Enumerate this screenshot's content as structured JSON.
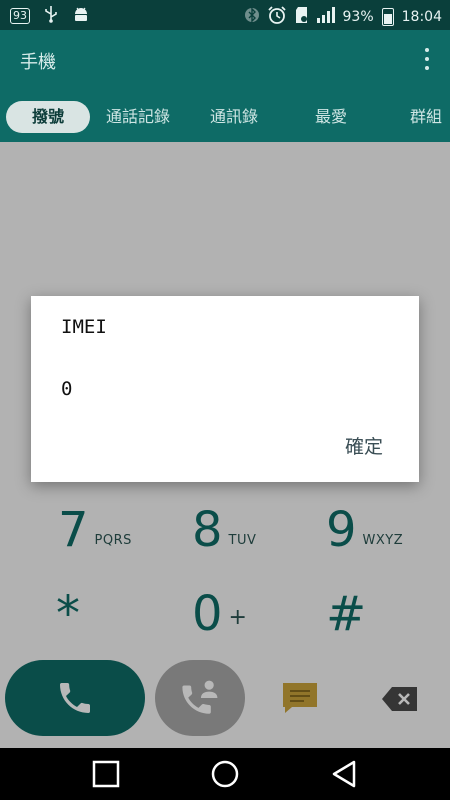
{
  "status_bar": {
    "notification_badge": "93",
    "battery_percent": "93%",
    "time": "18:04",
    "icons": [
      "notification-93-icon",
      "usb-icon",
      "android-icon",
      "bluetooth-icon",
      "alarm-icon",
      "sd-card-icon",
      "signal-icon",
      "battery-icon"
    ]
  },
  "app_bar": {
    "title": "手機",
    "menu_icon": "overflow-menu-icon"
  },
  "tabs": [
    {
      "label": "撥號",
      "active": true
    },
    {
      "label": "通話記錄"
    },
    {
      "label": "通訊錄"
    },
    {
      "label": "最愛"
    },
    {
      "label": "群組"
    }
  ],
  "keypad": {
    "keys": [
      {
        "digit": "7",
        "letters": "PQRS"
      },
      {
        "digit": "8",
        "letters": "TUV"
      },
      {
        "digit": "9",
        "letters": "WXYZ"
      },
      {
        "digit": "*",
        "letters": ""
      },
      {
        "digit": "0",
        "letters": "+"
      },
      {
        "digit": "#",
        "letters": ""
      }
    ]
  },
  "actions": {
    "call_icon": "phone-icon",
    "contact_icon": "add-contact-call-icon",
    "message_icon": "message-icon",
    "delete_icon": "backspace-icon"
  },
  "dialog": {
    "title": "IMEI",
    "value": "0",
    "ok_label": "確定"
  },
  "nav_bar": {
    "icons": [
      "recents-icon",
      "home-icon",
      "back-icon"
    ]
  },
  "colors": {
    "status_bar": "#0a3f3b",
    "primary": "#0e6b66",
    "active_tab_bg": "#d9e4e3",
    "dialog_button": "#3a4e55",
    "message_icon": "#c9a23b"
  }
}
